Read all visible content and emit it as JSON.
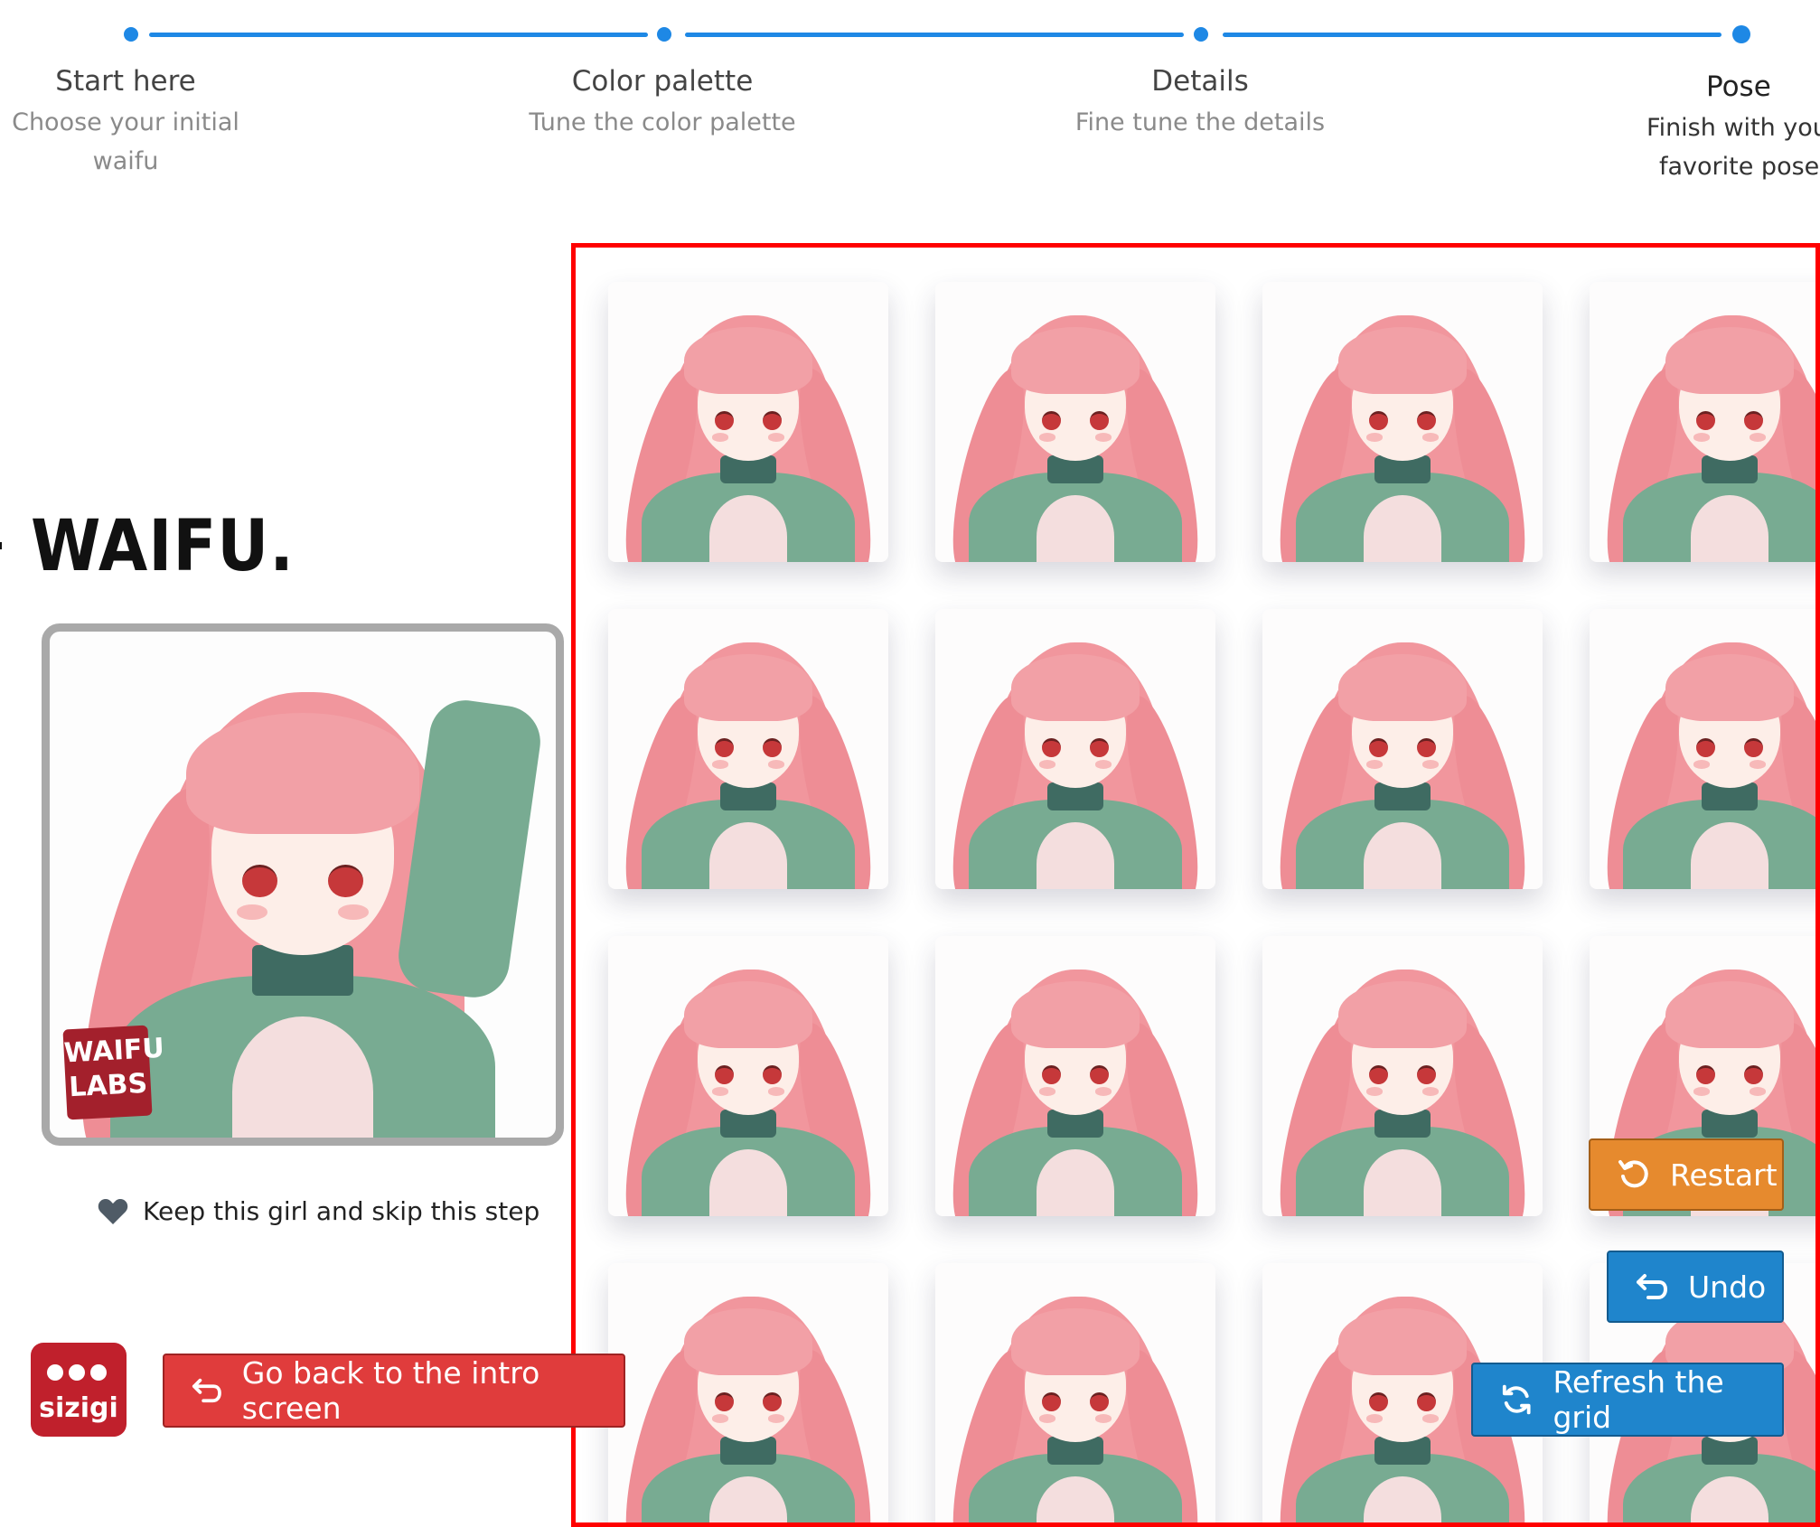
{
  "stepper": {
    "steps": [
      {
        "title": "Start here",
        "desc_line1": "Choose your initial",
        "desc_line2": "waifu"
      },
      {
        "title": "Color palette",
        "desc_line1": "Tune the color palette",
        "desc_line2": ""
      },
      {
        "title": "Details",
        "desc_line1": "Fine tune the details",
        "desc_line2": ""
      },
      {
        "title": "Pose",
        "desc_line1": "Finish with you",
        "desc_line2": "favorite pose!"
      }
    ],
    "accent": "#1e88e5"
  },
  "brand": {
    "text": "WAIFU."
  },
  "preview": {
    "stamp_line1": "WAIFU",
    "stamp_line2": "LABS"
  },
  "keep": {
    "label": "Keep this girl and skip this step",
    "icon": "heart-icon"
  },
  "sizigi": {
    "text": "sizigi"
  },
  "buttons": {
    "back": "Go back to the intro screen",
    "restart": "Restart",
    "undo": "Undo",
    "refresh": "Refresh the grid"
  },
  "colors": {
    "back": "#e03c3c",
    "restart": "#e68a2e",
    "undo": "#1f85cc",
    "refresh": "#1f85cc",
    "highlight": "#ff0000"
  }
}
